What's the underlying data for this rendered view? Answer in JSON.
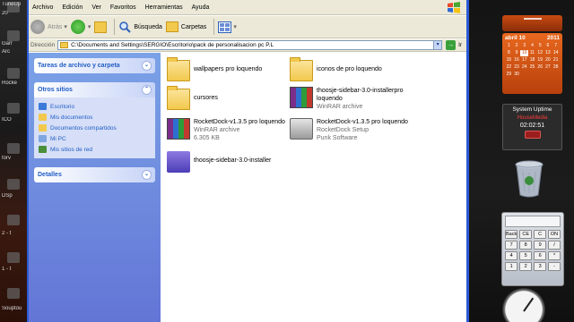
{
  "desktop": {
    "left_labels": [
      "TuneUp",
      "20",
      "Garr",
      "Arc",
      "Rocke",
      "ICO",
      "forv",
      "DSp",
      "2 - t",
      "1 - t",
      "Souptou"
    ]
  },
  "window": {
    "menu": [
      "Archivo",
      "Edición",
      "Ver",
      "Favoritos",
      "Herramientas",
      "Ayuda"
    ],
    "toolbar": {
      "back_label": "Atrás",
      "search_label": "Búsqueda",
      "folders_label": "Carpetas"
    },
    "address": {
      "label": "Dirección",
      "value": "C:\\Documents and Settings\\SERGIO\\Escritorio\\pack de personalisacion pc P.L",
      "go_label": "Ir"
    },
    "taskpane": {
      "tasks_title": "Tareas de archivo y carpeta",
      "other_title": "Otros sitios",
      "other_items": [
        "Escritorio",
        "Mis documentos",
        "Documentos compartidos",
        "Mi PC",
        "Mis sitios de red"
      ],
      "details_title": "Detalles"
    },
    "files": [
      {
        "name": "wallpapers pro loquendo",
        "type": "folder"
      },
      {
        "name": "iconos de pro loquendo",
        "type": "folder"
      },
      {
        "name": "cursores",
        "type": "folder"
      },
      {
        "name": "thoosje-sidebar-3.0-installerpro loquendo",
        "type": "rar",
        "sub1": "WinRAR archive"
      },
      {
        "name": "RocketDock-v1.3.5 pro loquendo",
        "type": "rar",
        "sub1": "WinRAR archive",
        "sub2": "6.305 KB"
      },
      {
        "name": "RocketDock-v1.3.5 pro loquendo",
        "type": "setup",
        "sub1": "RocketDock Setup",
        "sub2": "Punk Software"
      },
      {
        "name": "thoosje-sidebar-3.0-installer",
        "type": "installer"
      }
    ]
  },
  "widgets": {
    "calendar": {
      "month": "abril 10",
      "year": "2011",
      "days": [
        "1",
        "2",
        "3",
        "4",
        "5",
        "6",
        "7",
        "8",
        "9",
        "10",
        "11",
        "12",
        "13",
        "14",
        "15",
        "16",
        "17",
        "18",
        "19",
        "20",
        "21",
        "22",
        "23",
        "24",
        "25",
        "26",
        "27",
        "28",
        "29",
        "30"
      ],
      "today": "10"
    },
    "uptime": {
      "title": "System Uptime",
      "host": "HouseMedia",
      "time": "02:02:51"
    },
    "calculator": {
      "keys": [
        "Back",
        "CE",
        "C",
        "ON",
        "7",
        "8",
        "9",
        "/",
        "4",
        "5",
        "6",
        "*",
        "1",
        "2",
        "3",
        "-"
      ]
    }
  },
  "colors": {
    "xp_blue": "#2c5ad6",
    "taskpane_link": "#215dc6",
    "calendar_orange": "#e8681e"
  }
}
